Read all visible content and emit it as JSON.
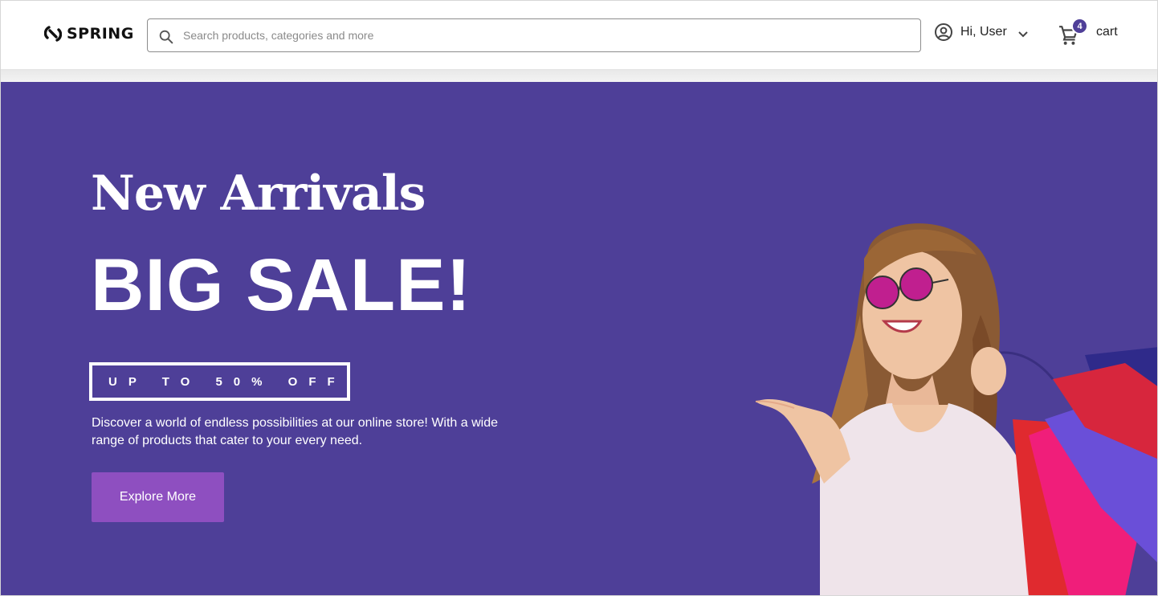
{
  "header": {
    "logo_text": "SPRING",
    "search_placeholder": "Search products, categories and more",
    "user_label": "Hi, User",
    "cart_label": "cart",
    "cart_count": "4"
  },
  "hero": {
    "subtitle": "New Arrivals",
    "title": "BIG SALE!",
    "discount": "UP TO 50% OFF",
    "description": "Discover a world of endless possibilities at our online store! With a wide range of products that cater to your every need.",
    "cta_label": "Explore More"
  },
  "colors": {
    "hero_bg": "#4e3f98",
    "cta_bg": "#8e4fc0",
    "badge_bg": "#4f3f98"
  },
  "icons": {
    "logo": "spring-logo-icon",
    "search": "search-icon",
    "user": "user-circle-icon",
    "chevron": "chevron-down-icon",
    "cart": "cart-icon"
  }
}
